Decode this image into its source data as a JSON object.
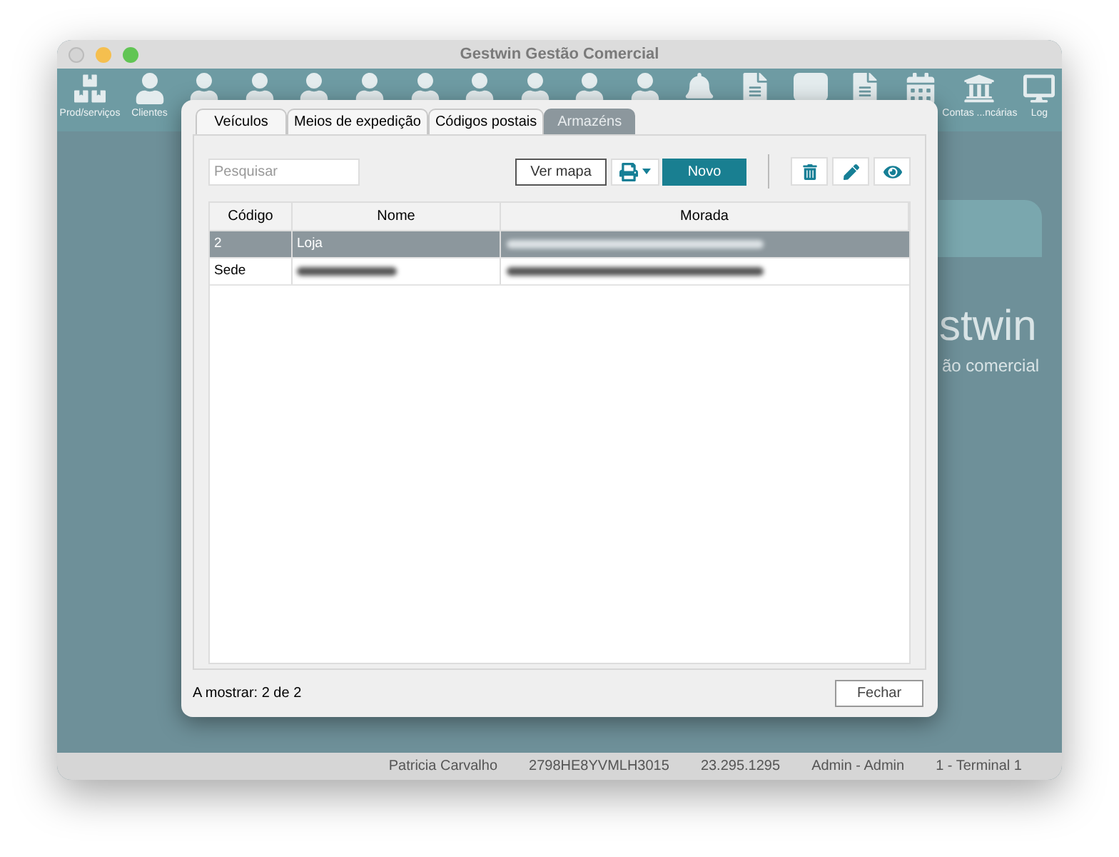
{
  "window": {
    "title": "Gestwin Gestão Comercial"
  },
  "toolbar": [
    {
      "kind": "box",
      "label": "Prod/serviços"
    },
    {
      "kind": "person",
      "label": "Clientes"
    },
    {
      "kind": "person"
    },
    {
      "kind": "person"
    },
    {
      "kind": "person"
    },
    {
      "kind": "person"
    },
    {
      "kind": "person"
    },
    {
      "kind": "person"
    },
    {
      "kind": "person"
    },
    {
      "kind": "person"
    },
    {
      "kind": "person"
    },
    {
      "kind": "bell"
    },
    {
      "kind": "doc"
    },
    {
      "kind": "blank"
    },
    {
      "kind": "doc"
    },
    {
      "kind": "calendar"
    },
    {
      "kind": "bank",
      "label": "Contas ...ncárias"
    },
    {
      "kind": "monitor",
      "label": "Log"
    }
  ],
  "background_logo": {
    "name": "stwin",
    "subtitle": "ão comercial"
  },
  "dialog": {
    "tabs": [
      {
        "label": "Veículos",
        "selected": false
      },
      {
        "label": "Meios de expedição",
        "selected": false
      },
      {
        "label": "Códigos postais",
        "selected": false
      },
      {
        "label": "Armazéns",
        "selected": true
      }
    ],
    "search": {
      "placeholder": "Pesquisar"
    },
    "buttons": {
      "map": "Ver mapa",
      "new": "Novo",
      "close": "Fechar"
    },
    "table": {
      "columns": [
        "Código",
        "Nome",
        "Morada"
      ],
      "rows": [
        {
          "codigo": "2",
          "nome": "Loja",
          "selected": true
        },
        {
          "codigo": "Sede",
          "selected": false
        }
      ]
    },
    "footer": "A mostrar: 2 de 2"
  },
  "status_bar": [
    "Patricia Carvalho",
    "2798HE8YVMLH3015",
    "23.295.1295",
    "Admin - Admin",
    "1 - Terminal 1"
  ]
}
